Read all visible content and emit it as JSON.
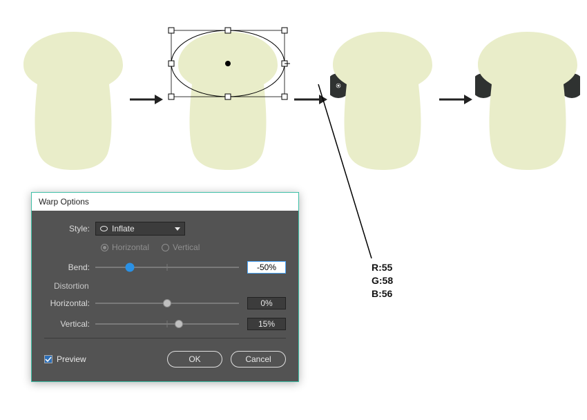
{
  "dialog": {
    "title": "Warp Options",
    "style_label": "Style:",
    "style_value": "Inflate",
    "orient_h": "Horizontal",
    "orient_v": "Vertical",
    "bend_label": "Bend:",
    "bend_value": "-50%",
    "distortion_label": "Distortion",
    "horiz_label": "Horizontal:",
    "horiz_value": "0%",
    "vert_label": "Vertical:",
    "vert_value": "15%",
    "preview_label": "Preview",
    "ok": "OK",
    "cancel": "Cancel"
  },
  "color_readout": {
    "r": "R:55",
    "g": "G:58",
    "b": "B:56"
  },
  "colors": {
    "shape_fill": "#e9edc9",
    "shape_shadow": "#dbe0b1",
    "ear": "#2f3231",
    "dialog_accent": "#3dbfa6"
  }
}
